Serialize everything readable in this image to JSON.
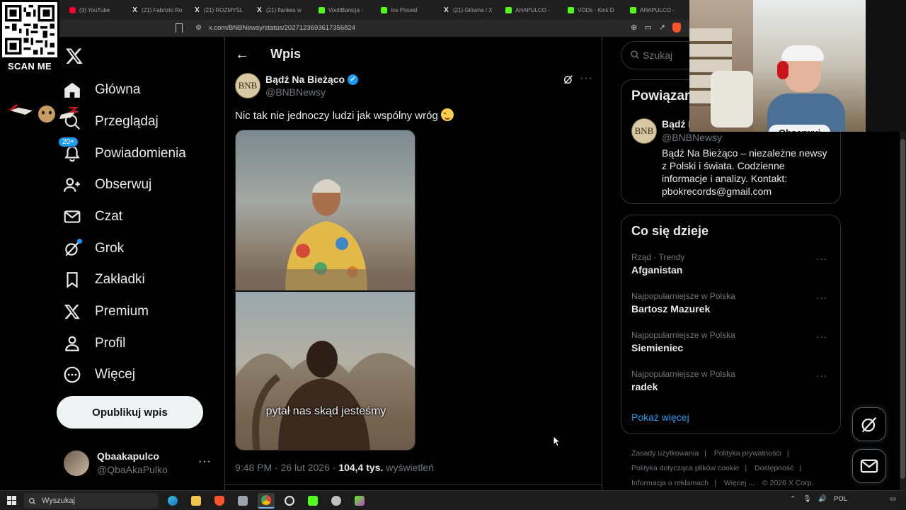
{
  "browser": {
    "tabs": [
      {
        "label": "(3) YouTube",
        "icon": "youtube-icon"
      },
      {
        "label": "(21) Fabrizio Ro",
        "icon": "x-icon"
      },
      {
        "label": "(21) ROZMYŚL",
        "icon": "x-icon"
      },
      {
        "label": "(21) flankes w",
        "icon": "x-icon"
      },
      {
        "label": "VooltBanicja -",
        "icon": "kick-icon"
      },
      {
        "label": "Ice Poseid",
        "icon": "kick-icon"
      },
      {
        "label": "(21) Główna / X",
        "icon": "x-icon"
      },
      {
        "label": "AHAPULCO -",
        "icon": "kick-icon"
      },
      {
        "label": "VODs - Kick D",
        "icon": "kick-icon"
      },
      {
        "label": "AHAPULCO -",
        "icon": "kick-icon"
      }
    ],
    "url": "x.com/BNBNewsy/status/2027123693617356824"
  },
  "overlay": {
    "scan_label": "SCAN ME"
  },
  "nav": {
    "items": [
      {
        "label": "Główna",
        "icon": "home-icon"
      },
      {
        "label": "Przeglądaj",
        "icon": "search-icon"
      },
      {
        "label": "Powiadomienia",
        "icon": "bell-icon",
        "badge": "20+"
      },
      {
        "label": "Obserwuj",
        "icon": "follow-icon"
      },
      {
        "label": "Czat",
        "icon": "mail-icon"
      },
      {
        "label": "Grok",
        "icon": "grok-icon"
      },
      {
        "label": "Zakładki",
        "icon": "bookmark-icon"
      },
      {
        "label": "Premium",
        "icon": "x-icon"
      },
      {
        "label": "Profil",
        "icon": "profile-icon"
      },
      {
        "label": "Więcej",
        "icon": "more-circle-icon"
      }
    ],
    "post_button": "Opublikuj wpis",
    "account": {
      "name": "Qbaakapulco",
      "handle": "@QbaAkaPulko"
    }
  },
  "post": {
    "header_title": "Wpis",
    "author_name": "Bądź Na Bieżąco",
    "author_handle": "@BNBNewsy",
    "avatar_text": "BNB",
    "text": "Nic tak nie jednoczy ludzi jak wspólny wróg",
    "media_caption": "pytał nas skąd jesteśmy",
    "time": "9:48 PM · 26 lut 2026 · ",
    "views_count": "104,4 tys.",
    "views_label": " wyświetleń"
  },
  "right": {
    "search_placeholder": "Szukaj",
    "related": {
      "title": "Powiązan",
      "name": "Bądź I",
      "handle": "@BNBNewsy",
      "avatar_text": "BNB",
      "follow_label": "Obserwuj",
      "bio": "Bądź Na Bieżąco – niezależne newsy z Polski i świata. Codzienne informacje i analizy. Kontakt: pbokrecords@gmail.com"
    },
    "trends": {
      "title": "Co się dzieje",
      "items": [
        {
          "meta": "Rząd · Trendy",
          "name": "Afganistan"
        },
        {
          "meta": "Najpopularniejsze w Polska",
          "name": "Bartosz Mazurek"
        },
        {
          "meta": "Najpopularniejsze w Polska",
          "name": "Siemieniec"
        },
        {
          "meta": "Najpopularniejsze w Polska",
          "name": "radek"
        }
      ],
      "show_more": "Pokaż więcej"
    },
    "footer": {
      "links": [
        "Zasady użytkowania",
        "Polityka prywatności",
        "Polityka dotycząca plików cookie",
        "Dostępność",
        "Informacja o reklamach",
        "Więcej ...",
        "© 2026 X Corp."
      ]
    }
  },
  "taskbar": {
    "search_label": "Wyszukaj",
    "lang": "POL"
  },
  "colors": {
    "accent": "#1d9bf0",
    "background": "#000000",
    "text": "#e7e9ea",
    "muted": "#71767b",
    "border": "#2f3336"
  }
}
